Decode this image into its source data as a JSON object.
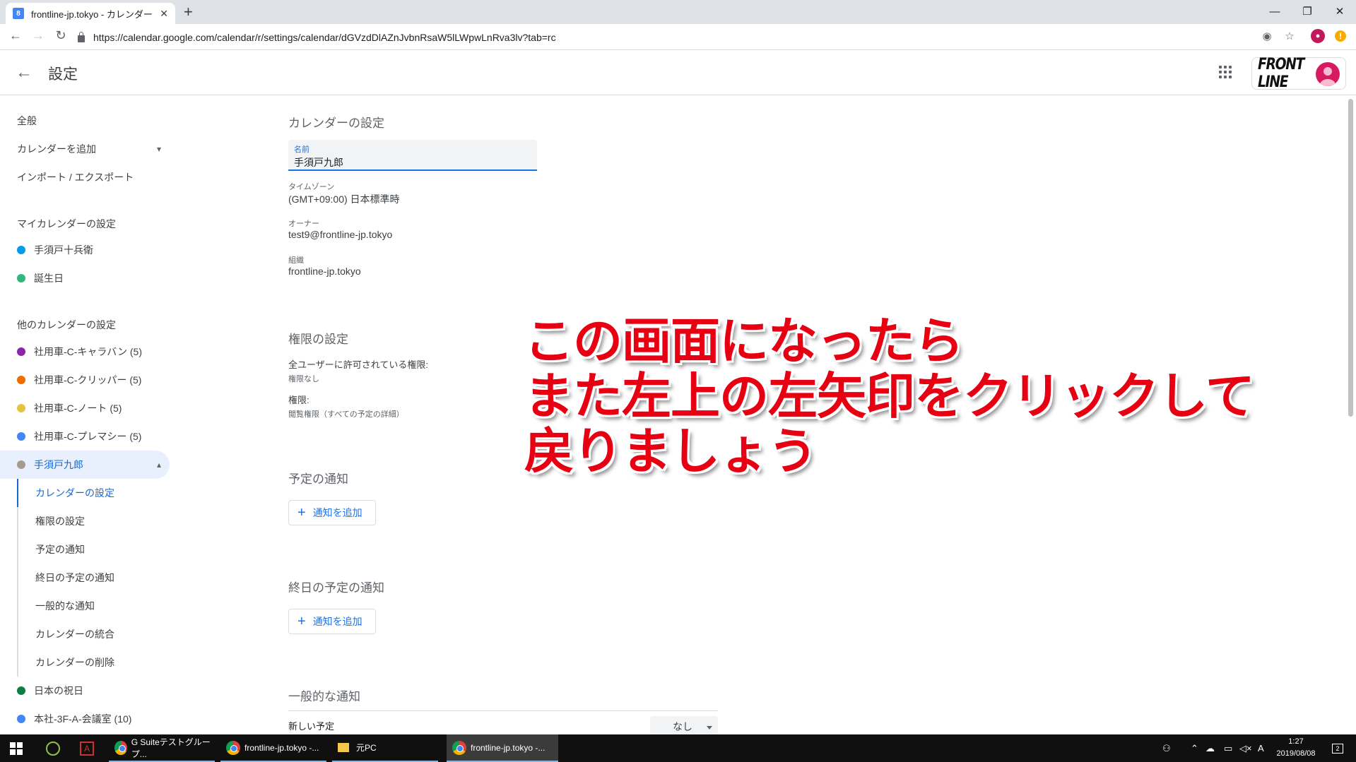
{
  "browser": {
    "tab_title": "frontline-jp.tokyo - カレンダー - 「手",
    "tab_favicon": "8",
    "url": "https://calendar.google.com/calendar/r/settings/calendar/dGVzdDlAZnJvbnRsaW5lLWpwLnRva3lv?tab=rc"
  },
  "header": {
    "title": "設定",
    "brand": "FRONT LINE"
  },
  "sidebar": {
    "general": "全般",
    "add_calendar": "カレンダーを追加",
    "import_export": "インポート / エクスポート",
    "my_calendars_heading": "マイカレンダーの設定",
    "my_calendars": [
      {
        "label": "手須戸十兵衛",
        "color": "#039be5"
      },
      {
        "label": "誕生日",
        "color": "#33b679"
      }
    ],
    "other_calendars_heading": "他のカレンダーの設定",
    "other_calendars": [
      {
        "label": "社用車-C-キャラバン (5)",
        "color": "#8e24aa"
      },
      {
        "label": "社用車-C-クリッパー (5)",
        "color": "#ef6c00"
      },
      {
        "label": "社用車-C-ノート (5)",
        "color": "#e4c441"
      },
      {
        "label": "社用車-C-プレマシー (5)",
        "color": "#4285f4"
      }
    ],
    "selected_calendar": {
      "label": "手須戸九郎",
      "color": "#a79b8e"
    },
    "sub_items": [
      "カレンダーの設定",
      "権限の設定",
      "予定の通知",
      "終日の予定の通知",
      "一般的な通知",
      "カレンダーの統合",
      "カレンダーの削除"
    ],
    "after_calendars": [
      {
        "label": "日本の祝日",
        "color": "#0b8043"
      },
      {
        "label": "本社-3F-A-会議室 (10)",
        "color": "#4285f4"
      }
    ]
  },
  "main": {
    "calendar_settings_title": "カレンダーの設定",
    "name_label": "名前",
    "name_value": "手須戸九郎",
    "timezone_label": "タイムゾーン",
    "timezone_value": "(GMT+09:00) 日本標準時",
    "owner_label": "オーナー",
    "owner_value": "test9@frontline-jp.tokyo",
    "org_label": "組織",
    "org_value": "frontline-jp.tokyo",
    "permissions_title": "権限の設定",
    "all_users_label": "全ユーザーに許可されている権限:",
    "all_users_value": "権限なし",
    "permission_label": "権限:",
    "permission_value": "閲覧権限（すべての予定の詳細）",
    "event_notify_title": "予定の通知",
    "add_notification": "通知を追加",
    "allday_notify_title": "終日の予定の通知",
    "general_notify_title": "一般的な通知",
    "new_event_label": "新しい予定",
    "new_event_value": "なし"
  },
  "overlay": {
    "line1": "この画面になったら",
    "line2": "また左上の左矢印をクリックして",
    "line3": "戻りましょう",
    "color": "#e60012"
  },
  "taskbar": {
    "apps": [
      {
        "label": "G Suiteテストグループ..."
      },
      {
        "label": "frontline-jp.tokyo -..."
      },
      {
        "label": "元PC"
      },
      {
        "label": "frontline-jp.tokyo -..."
      }
    ],
    "ime": "A",
    "time": "1:27",
    "date": "2019/08/08",
    "notifications": "2"
  }
}
